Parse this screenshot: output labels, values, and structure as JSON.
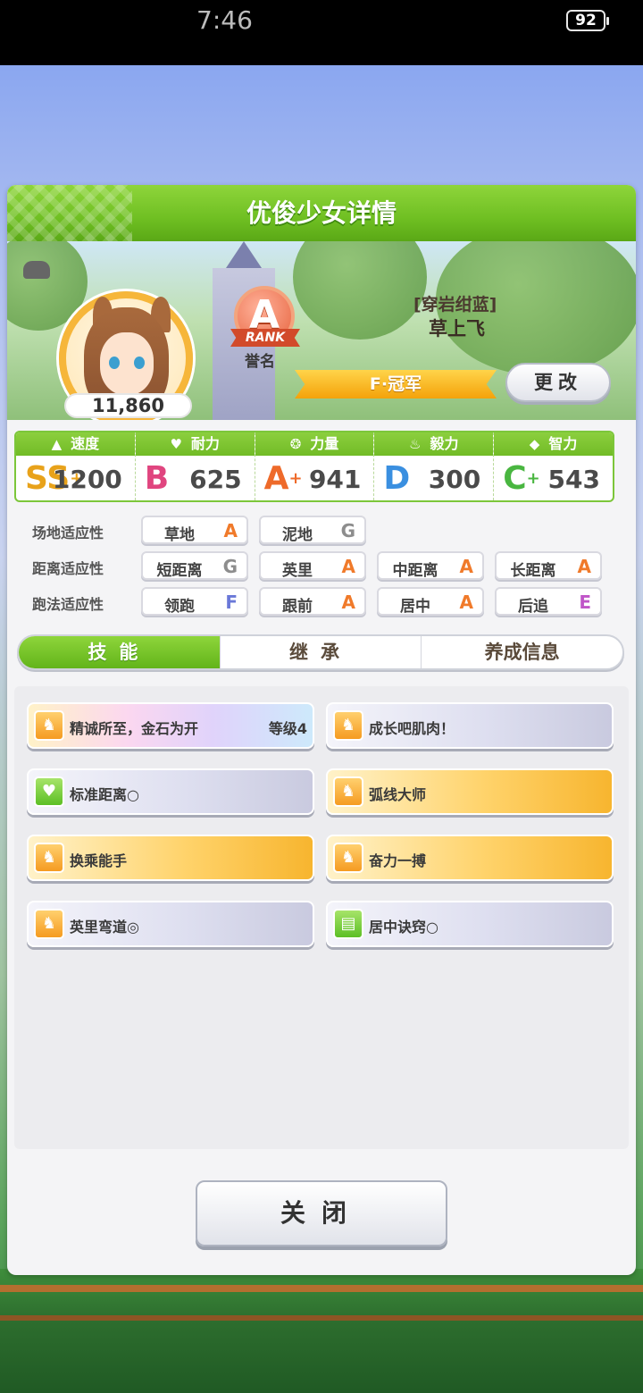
{
  "statusbar": {
    "time": "7:46",
    "battery": "92"
  },
  "dialog": {
    "title": "优俊少女详情",
    "score": "11,860",
    "rank_letter": "A",
    "rank_word": "RANK",
    "rank_label": "誉名",
    "epithet": "[穿岩绀蓝]",
    "horse_name": "草上飞",
    "title_ribbon": "F·冠军",
    "change_label": "更改"
  },
  "stats": [
    {
      "name": "速度",
      "icon": "shoe-icon",
      "grade": "SS",
      "plus": "+",
      "value": "1200",
      "color": "#e8a21a"
    },
    {
      "name": "耐力",
      "icon": "heart-icon",
      "grade": "B",
      "plus": "",
      "value": "625",
      "color": "#e0457f"
    },
    {
      "name": "力量",
      "icon": "muscle-icon",
      "grade": "A",
      "plus": "+",
      "value": "941",
      "color": "#ee6a2a"
    },
    {
      "name": "毅力",
      "icon": "flame-icon",
      "grade": "D",
      "plus": "",
      "value": "300",
      "color": "#3a8fe0"
    },
    {
      "name": "智力",
      "icon": "graduation-cap-icon",
      "grade": "C",
      "plus": "+",
      "value": "543",
      "color": "#49b640"
    }
  ],
  "aptitude": {
    "track": {
      "label": "场地适应性",
      "items": [
        {
          "name": "草地",
          "grade": "A"
        },
        {
          "name": "泥地",
          "grade": "G"
        }
      ]
    },
    "distance": {
      "label": "距离适应性",
      "items": [
        {
          "name": "短距离",
          "grade": "G"
        },
        {
          "name": "英里",
          "grade": "A"
        },
        {
          "name": "中距离",
          "grade": "A"
        },
        {
          "name": "长距离",
          "grade": "A"
        }
      ]
    },
    "style": {
      "label": "跑法适应性",
      "items": [
        {
          "name": "领跑",
          "grade": "F"
        },
        {
          "name": "跟前",
          "grade": "A"
        },
        {
          "name": "居中",
          "grade": "A"
        },
        {
          "name": "后追",
          "grade": "E"
        }
      ]
    }
  },
  "grade_colors": {
    "A": "#f07a2a",
    "G": "#8d8d8d",
    "F": "#6a78d8",
    "E": "#c055c8"
  },
  "tabs": [
    {
      "label": "技能",
      "active": true
    },
    {
      "label": "继承",
      "active": false
    },
    {
      "label": "养成信息",
      "active": false
    }
  ],
  "skills": [
    {
      "name": "精诚所至，金石为开",
      "level": "等级4",
      "style": "rainbow",
      "icon": "running-horse-icon"
    },
    {
      "name": "成长吧肌肉！",
      "level": "",
      "style": "grey",
      "icon": "running-horse-icon"
    },
    {
      "name": "标准距离○",
      "level": "",
      "style": "grey",
      "icon": "heart-icon"
    },
    {
      "name": "弧线大师",
      "level": "",
      "style": "gold",
      "icon": "running-horse-icon"
    },
    {
      "name": "换乘能手",
      "level": "",
      "style": "gold",
      "icon": "running-horse-icon"
    },
    {
      "name": "奋力一搏",
      "level": "",
      "style": "gold",
      "icon": "running-horse-icon"
    },
    {
      "name": "英里弯道◎",
      "level": "",
      "style": "grey",
      "icon": "running-horse-icon"
    },
    {
      "name": "居中诀窍○",
      "level": "",
      "style": "grey",
      "icon": "book-icon"
    }
  ],
  "close_label": "关闭"
}
